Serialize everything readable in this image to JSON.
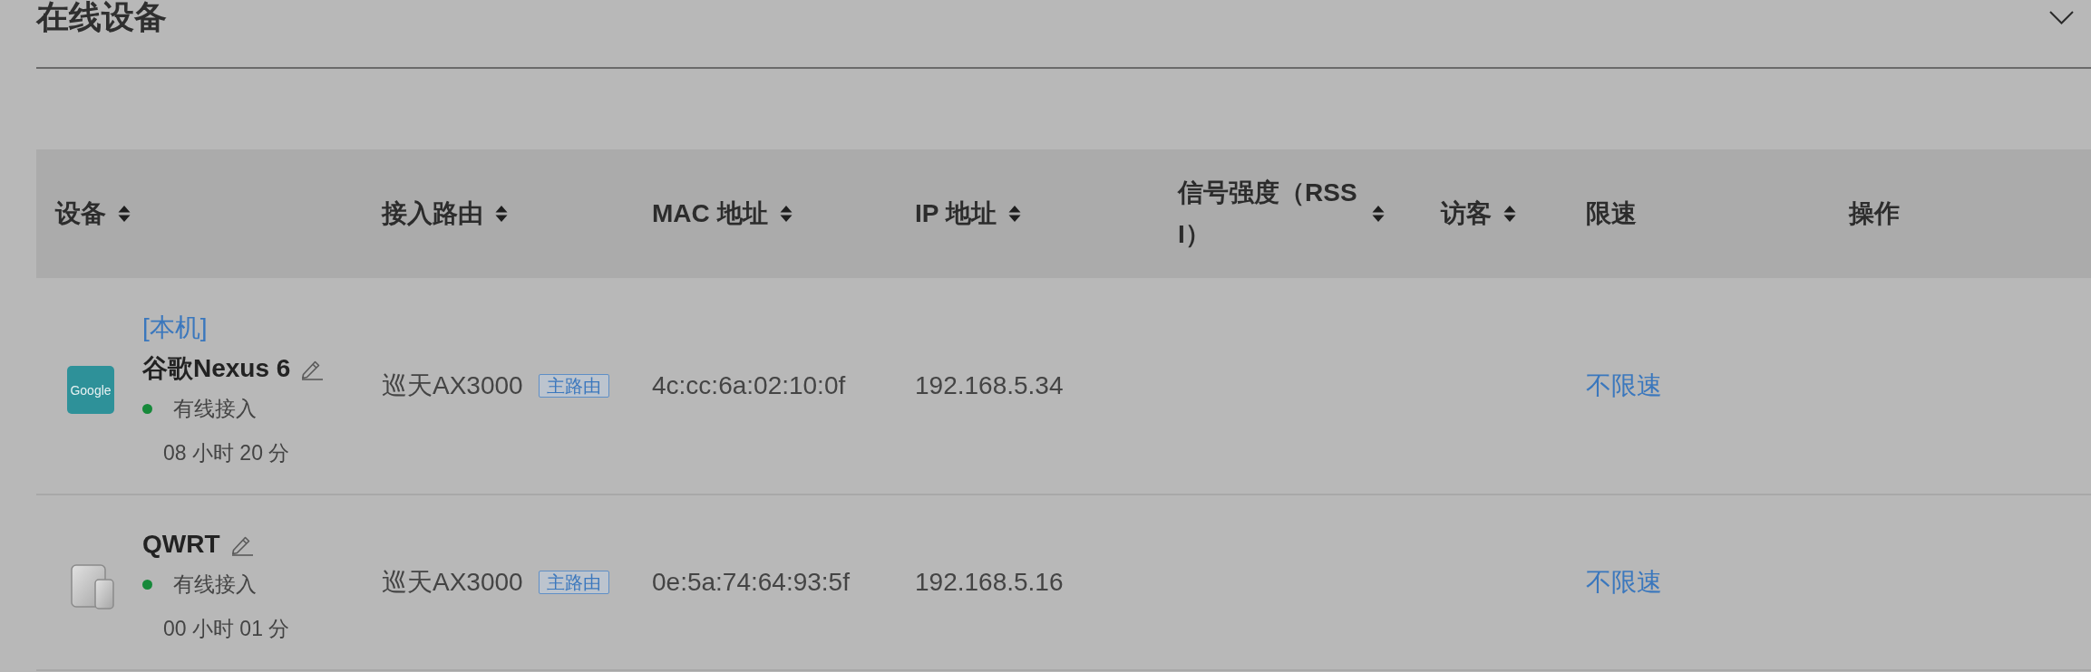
{
  "section": {
    "title": "在线设备"
  },
  "table": {
    "columns": [
      {
        "label": "设备",
        "sortable": true
      },
      {
        "label": "接入路由",
        "sortable": true
      },
      {
        "label": "MAC 地址",
        "sortable": true
      },
      {
        "label": "IP 地址",
        "sortable": true
      },
      {
        "label": "信号强度（RSSI）",
        "sortable": true
      },
      {
        "label": "访客",
        "sortable": true
      },
      {
        "label": "限速",
        "sortable": false
      },
      {
        "label": "操作",
        "sortable": false
      }
    ],
    "rows": [
      {
        "device": {
          "icon": {
            "kind": "logo",
            "text": "Google"
          },
          "tag": "[本机]",
          "name": "谷歌Nexus 6",
          "online": true,
          "connection": "有线接入",
          "duration": "08 小时 20 分"
        },
        "router": "巡天AX3000",
        "router_badge": "主路由",
        "mac": "4c:cc:6a:02:10:0f",
        "ip": "192.168.5.34",
        "speed_limit": "不限速"
      },
      {
        "device": {
          "icon": {
            "kind": "tablet_phone"
          },
          "name": "QWRT",
          "online": true,
          "connection": "有线接入",
          "duration": "00 小时 01 分"
        },
        "router": "巡天AX3000",
        "router_badge": "主路由",
        "mac": "0e:5a:74:64:93:5f",
        "ip": "192.168.5.16",
        "speed_limit": "不限速"
      }
    ]
  }
}
